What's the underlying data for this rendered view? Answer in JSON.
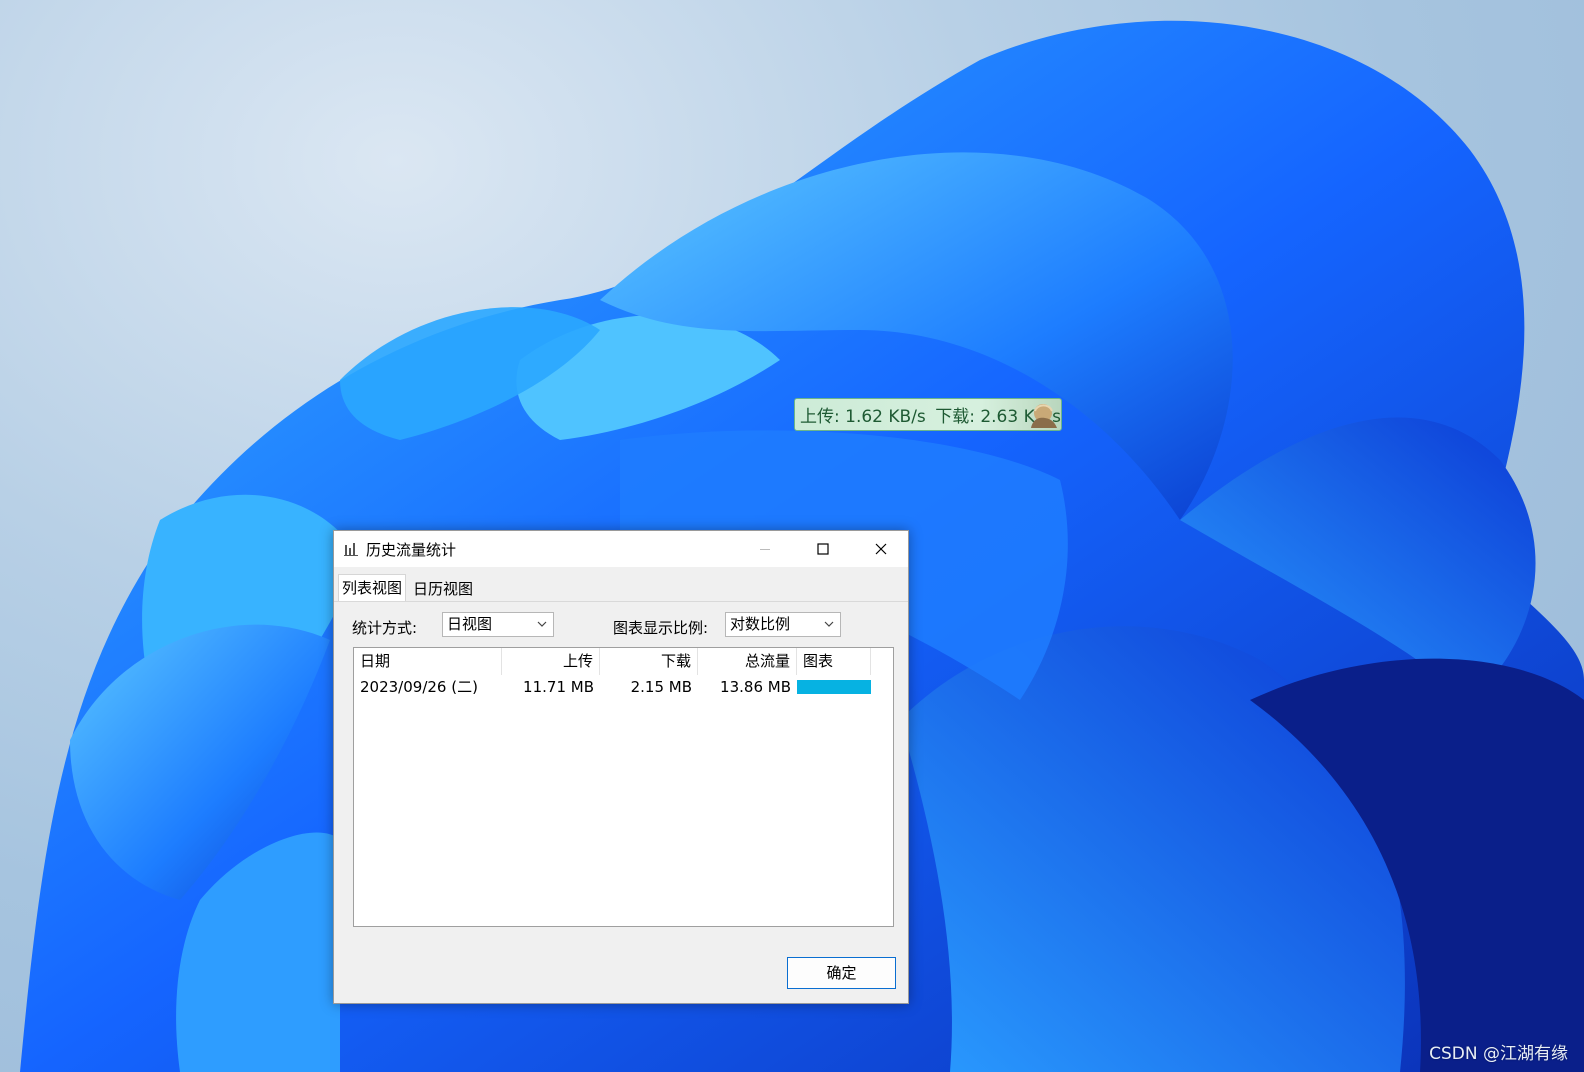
{
  "desktop": {
    "watermark": "CSDN @江湖有缘"
  },
  "speed_widget": {
    "upload": "上传: 1.62 KB/s",
    "download": "下载: 2.63 KB/s",
    "bg_color": "#cdebd7",
    "text_color": "#1e5a33"
  },
  "dialog": {
    "title": "历史流量统计",
    "icon": "bar-chart-icon",
    "tabs": [
      {
        "label": "列表视图",
        "active": true
      },
      {
        "label": "日历视图",
        "active": false
      }
    ],
    "stat_method_label": "统计方式:",
    "stat_method_value": "日视图",
    "scale_label": "图表显示比例:",
    "scale_value": "对数比例",
    "columns": [
      "日期",
      "上传",
      "下载",
      "总流量",
      "图表"
    ],
    "rows": [
      {
        "date": "2023/09/26 (二)",
        "upload": "11.71 MB",
        "download": "2.15 MB",
        "total": "13.86 MB",
        "bar_fraction": 1.0
      }
    ],
    "ok_label": "确定",
    "bar_color": "#06b2e2",
    "accent_color": "#0a6ed1"
  }
}
